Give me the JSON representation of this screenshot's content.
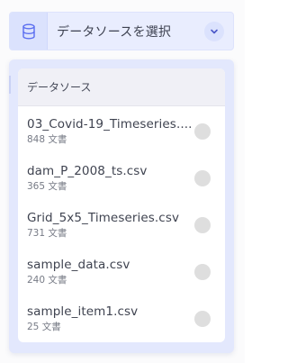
{
  "selector": {
    "label": "データソースを選択",
    "icon": "database-icon",
    "dropdown_icon": "chevron-down-icon"
  },
  "dropdown": {
    "header": "データソース",
    "items": [
      {
        "name": "03_Covid-19_Timeseries....",
        "meta": "848 文書"
      },
      {
        "name": "dam_P_2008_ts.csv",
        "meta": "365 文書"
      },
      {
        "name": "Grid_5x5_Timeseries.csv",
        "meta": "731 文書"
      },
      {
        "name": "sample_data.csv",
        "meta": "240 文書"
      },
      {
        "name": "sample_item1.csv",
        "meta": "25 文書"
      }
    ]
  },
  "colors": {
    "accent_bg": "#e9edfe",
    "icon_color": "#5b6ef0",
    "radio": "#dedede"
  }
}
